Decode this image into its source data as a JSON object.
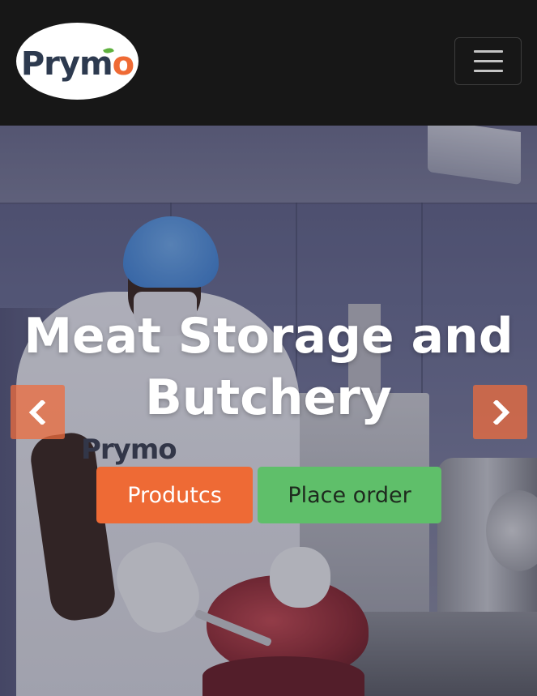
{
  "navbar": {
    "brand_text": "Prym",
    "brand_accent_letter": "o",
    "toggler_icon": "hamburger-icon"
  },
  "hero": {
    "title": "Meat Storage and Butchery",
    "buttons": {
      "products_label": "Produtcs",
      "order_label": "Place order"
    },
    "controls": {
      "prev_icon": "chevron-left-icon",
      "next_icon": "chevron-right-icon"
    },
    "coat_logo": "Prymo"
  },
  "colors": {
    "navbar_bg": "#171717",
    "brand_dark": "#2d3a4f",
    "brand_orange": "#ef6a34",
    "brand_green": "#5fb13f",
    "products_button": "#ee6a35",
    "order_button": "#5fbf6a"
  }
}
